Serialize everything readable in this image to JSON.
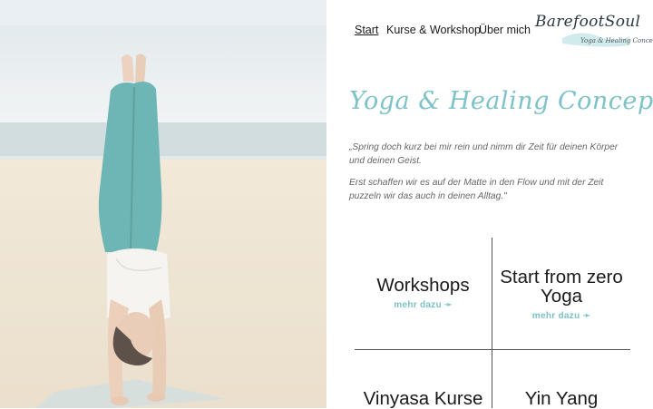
{
  "nav": {
    "items": [
      {
        "label": "Start"
      },
      {
        "label": "Kurse & Workshop"
      },
      {
        "label": "Über mich"
      }
    ]
  },
  "logo": {
    "name": "BarefootSoul",
    "tagline": "Yoga & Healing Concepts"
  },
  "main": {
    "headline": "Yoga & Healing Concepts",
    "quote_1": "„Spring doch kurz bei mir rein und nimm dir Zeit für deinen Körper und deinen Geist.",
    "quote_2": "Erst schaffen wir es auf der Matte in den Flow und mit der Zeit puzzeln wir das auch in deinen Alltag.\""
  },
  "offers": [
    {
      "title": "Workshops",
      "more": "mehr dazu ➛"
    },
    {
      "title": "Start from zero Yoga",
      "more": "mehr dazu ➛"
    },
    {
      "title": "Vinyasa Kurse"
    },
    {
      "title": "Yin Yang"
    }
  ],
  "colors": {
    "accent": "#7cc2c6",
    "sand": "#efe3cf",
    "sea": "#c7d5d8",
    "sky": "#e9eef0",
    "leggings": "#4aa3a3"
  },
  "icons": {
    "arrow": "arrow-right-icon"
  }
}
